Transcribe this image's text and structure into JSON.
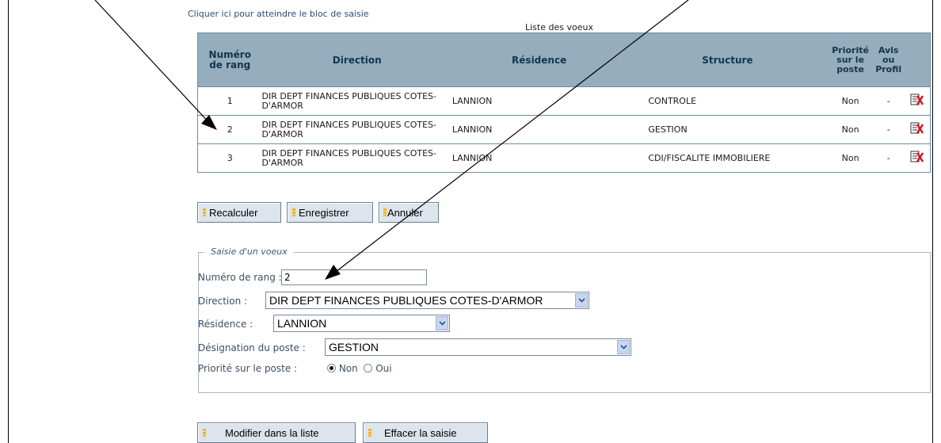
{
  "skip_link": "Cliquer ici pour atteindre le bloc de saisie",
  "list_caption": "Liste des voeux",
  "table": {
    "headers": {
      "rank": "Numéro de rang",
      "direction": "Direction",
      "residence": "Résidence",
      "structure": "Structure",
      "priority": "Priorité sur le poste",
      "opinion": "Avis ou Profil"
    },
    "rows": [
      {
        "rank": "1",
        "direction": "DIR DEPT FINANCES PUBLIQUES COTES-D'ARMOR",
        "residence": "LANNION",
        "structure": "CONTROLE",
        "priority": "Non",
        "opinion": "-"
      },
      {
        "rank": "2",
        "direction": "DIR DEPT FINANCES PUBLIQUES COTES-D'ARMOR",
        "residence": "LANNION",
        "structure": "GESTION",
        "priority": "Non",
        "opinion": "-"
      },
      {
        "rank": "3",
        "direction": "DIR DEPT FINANCES PUBLIQUES COTES-D'ARMOR",
        "residence": "LANNION",
        "structure": "CDI/FISCALITE IMMOBILIERE",
        "priority": "Non",
        "opinion": "-"
      }
    ]
  },
  "buttons": {
    "recalculate": "Recalculer",
    "save": "Enregistrer",
    "cancel": "Annuler",
    "modify": "Modifier dans la liste",
    "clear": "Effacer la saisie"
  },
  "entry": {
    "legend": "Saisie d'un voeux",
    "rank_label": "Numéro de rang :",
    "rank_value": "2",
    "direction_label": "Direction :",
    "direction_value": "DIR DEPT FINANCES PUBLIQUES COTES-D'ARMOR",
    "residence_label": "Résidence :",
    "residence_value": "LANNION",
    "post_label": "Désignation du poste :",
    "post_value": "GESTION",
    "priority_label": "Priorité sur le poste :",
    "priority_options": [
      "Non",
      "Oui"
    ],
    "priority_selected": "Non"
  },
  "colors": {
    "header_bg": "#95adbd",
    "header_text": "#13354f",
    "delete_icon": "#d8101a",
    "button_bullet": "#f5b400"
  },
  "icons": {
    "delete": "delete-row-icon",
    "dropdown": "chevron-down-icon"
  }
}
